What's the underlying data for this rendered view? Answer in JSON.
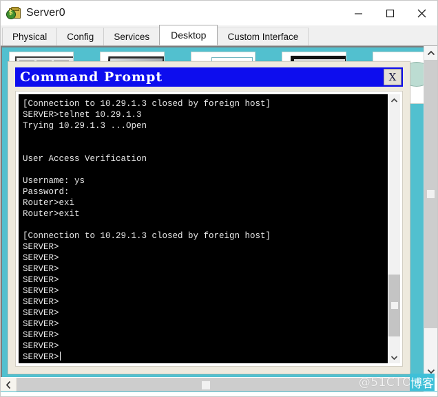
{
  "window": {
    "title": "Server0",
    "icon": "server-bag-icon",
    "controls": {
      "minimize": "minimize-icon",
      "maximize": "maximize-icon",
      "close": "close-icon"
    }
  },
  "tabs": [
    {
      "label": "Physical",
      "active": false
    },
    {
      "label": "Config",
      "active": false
    },
    {
      "label": "Services",
      "active": false
    },
    {
      "label": "Desktop",
      "active": true
    },
    {
      "label": "Custom Interface",
      "active": false
    }
  ],
  "desktop": {
    "background_color": "#52c0cf",
    "icons": [
      {
        "name": "ip-configuration-icon"
      },
      {
        "name": "dial-up-icon"
      },
      {
        "name": "terminal-icon"
      },
      {
        "name": "command-prompt-icon"
      },
      {
        "name": "web-browser-icon"
      }
    ]
  },
  "command_prompt": {
    "title": "Command Prompt",
    "title_bg": "#0d0dee",
    "close_label": "X",
    "terminal_bg": "#000000",
    "terminal_fg": "#e8e8e8",
    "lines": [
      "[Connection to 10.29.1.3 closed by foreign host]",
      "SERVER>telnet 10.29.1.3",
      "Trying 10.29.1.3 ...Open",
      "",
      "",
      "User Access Verification",
      "",
      "Username: ys",
      "Password:",
      "Router>exi",
      "Router>exit",
      "",
      "[Connection to 10.29.1.3 closed by foreign host]",
      "SERVER>",
      "SERVER>",
      "SERVER>",
      "SERVER>",
      "SERVER>",
      "SERVER>",
      "SERVER>",
      "SERVER>",
      "SERVER>",
      "SERVER>",
      "SERVER>"
    ],
    "prompt_line": "SERVER>",
    "scrollbar": {
      "up_arrow": "chevron-up-icon",
      "down_arrow": "chevron-down-icon"
    }
  },
  "outer_scrollbars": {
    "vertical": {
      "up_arrow": "chevron-up-icon",
      "down_arrow": "chevron-down-icon"
    },
    "horizontal": {
      "left_arrow": "chevron-left-icon"
    }
  },
  "watermark": {
    "latin": "@51CTO",
    "cjk": "博客"
  }
}
